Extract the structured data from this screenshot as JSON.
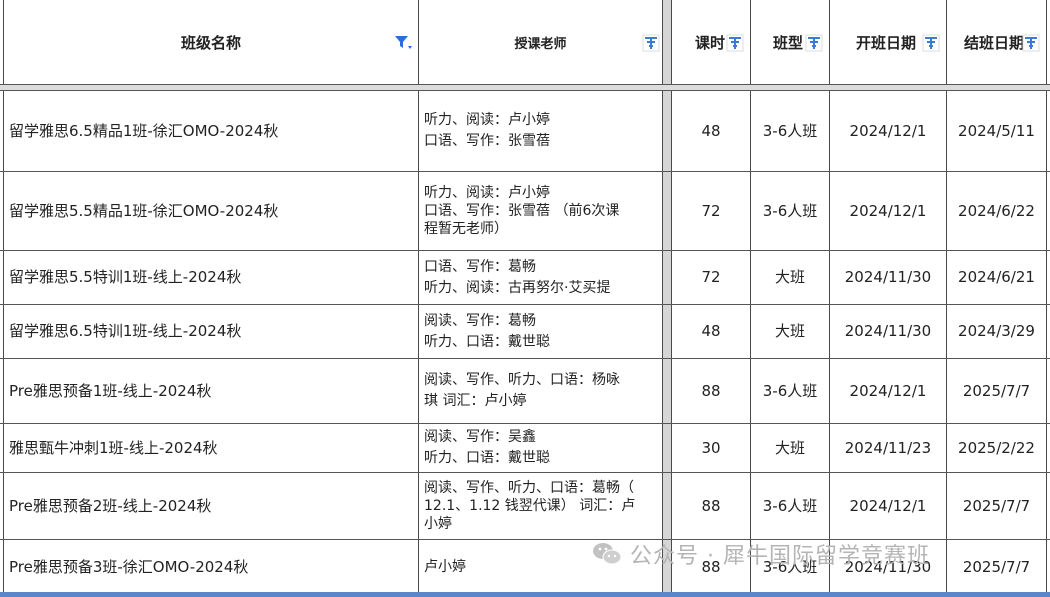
{
  "headers": {
    "class_name": "班级名称",
    "teacher": "授课老师",
    "hours": "课时",
    "class_type": "班型",
    "start_date": "开班日期",
    "end_date": "结班日期"
  },
  "rows": [
    {
      "name": "留学雅思6.5精品1班-徐汇OMO-2024秋",
      "teacher": "听力、阅读：卢小婷\n口语、写作：张雪蓓",
      "hours": "48",
      "type": "3-6人班",
      "start": "2024/12/1",
      "end": "2024/5/11"
    },
    {
      "name": "留学雅思5.5精品1班-徐汇OMO-2024秋",
      "teacher": "听力、阅读：卢小婷\n口语、写作：张雪蓓 （前6次课\n程暂无老师）",
      "hours": "72",
      "type": "3-6人班",
      "start": "2024/12/1",
      "end": "2024/6/22"
    },
    {
      "name": "留学雅思5.5特训1班-线上-2024秋",
      "teacher": "口语、写作：葛畅\n听力、阅读：古再努尔·艾买提",
      "hours": "72",
      "type": "大班",
      "start": "2024/11/30",
      "end": "2024/6/21"
    },
    {
      "name": "留学雅思6.5特训1班-线上-2024秋",
      "teacher": "阅读、写作：葛畅\n听力、口语：戴世聪",
      "hours": "48",
      "type": "大班",
      "start": "2024/11/30",
      "end": "2024/3/29"
    },
    {
      "name": "Pre雅思预备1班-线上-2024秋",
      "teacher": "阅读、写作、听力、口语：杨咏\n琪          词汇：卢小婷",
      "hours": "88",
      "type": "3-6人班",
      "start": "2024/12/1",
      "end": "2025/7/7"
    },
    {
      "name": "雅思甄牛冲刺1班-线上-2024秋",
      "teacher": "阅读、写作：吴鑫\n听力、口语：戴世聪",
      "hours": "30",
      "type": "大班",
      "start": "2024/11/23",
      "end": "2025/2/22"
    },
    {
      "name": "Pre雅思预备2班-线上-2024秋",
      "teacher": "阅读、写作、听力、口语：葛畅（\n12.1、1.12 钱翌代课）    词汇：卢\n小婷",
      "hours": "88",
      "type": "3-6人班",
      "start": "2024/12/1",
      "end": "2025/7/7"
    },
    {
      "name": "Pre雅思预备3班-徐汇OMO-2024秋",
      "teacher": "卢小婷",
      "hours": "88",
      "type": "3-6人班",
      "start": "2024/11/30",
      "end": "2025/7/7"
    }
  ],
  "watermark": {
    "text": "公众号 · 犀牛国际留学竞赛班",
    "icon": "wechat-logo-icon"
  },
  "colors": {
    "filter_active": "#2b6fd6",
    "filter_icon": "#3a7bd5",
    "grid": "#4a4a4a",
    "watermark": "#b4b4b4"
  }
}
